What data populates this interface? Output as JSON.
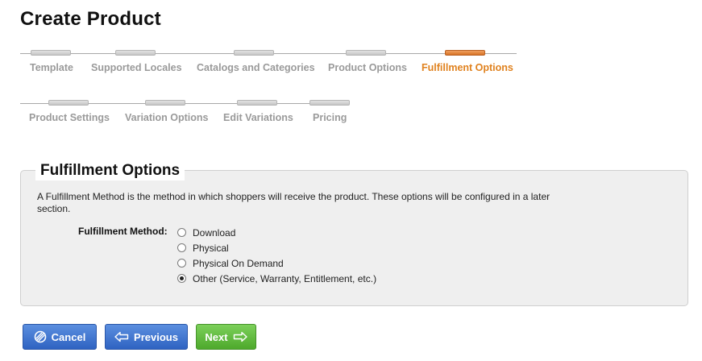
{
  "page": {
    "title": "Create Product"
  },
  "wizard": {
    "steps": [
      {
        "label": "Template"
      },
      {
        "label": "Supported Locales"
      },
      {
        "label": "Catalogs and Categories"
      },
      {
        "label": "Product Options"
      },
      {
        "label": "Fulfillment Options",
        "active": true
      },
      {
        "label": "Product Settings"
      },
      {
        "label": "Variation Options"
      },
      {
        "label": "Edit Variations"
      },
      {
        "label": "Pricing"
      }
    ],
    "colors": {
      "active": "#e0821f",
      "inactive": "#9a9a9a"
    }
  },
  "section": {
    "title": "Fulfillment Options",
    "description": "A Fulfillment Method is the method in which shoppers will receive the product. These options will be configured in a later section.",
    "field_label": "Fulfillment Method:",
    "options": [
      {
        "label": "Download",
        "checked": false
      },
      {
        "label": "Physical",
        "checked": false
      },
      {
        "label": "Physical On Demand",
        "checked": false
      },
      {
        "label": "Other (Service, Warranty, Entitlement, etc.)",
        "checked": true
      }
    ]
  },
  "buttons": {
    "cancel": "Cancel",
    "previous": "Previous",
    "next": "Next"
  }
}
